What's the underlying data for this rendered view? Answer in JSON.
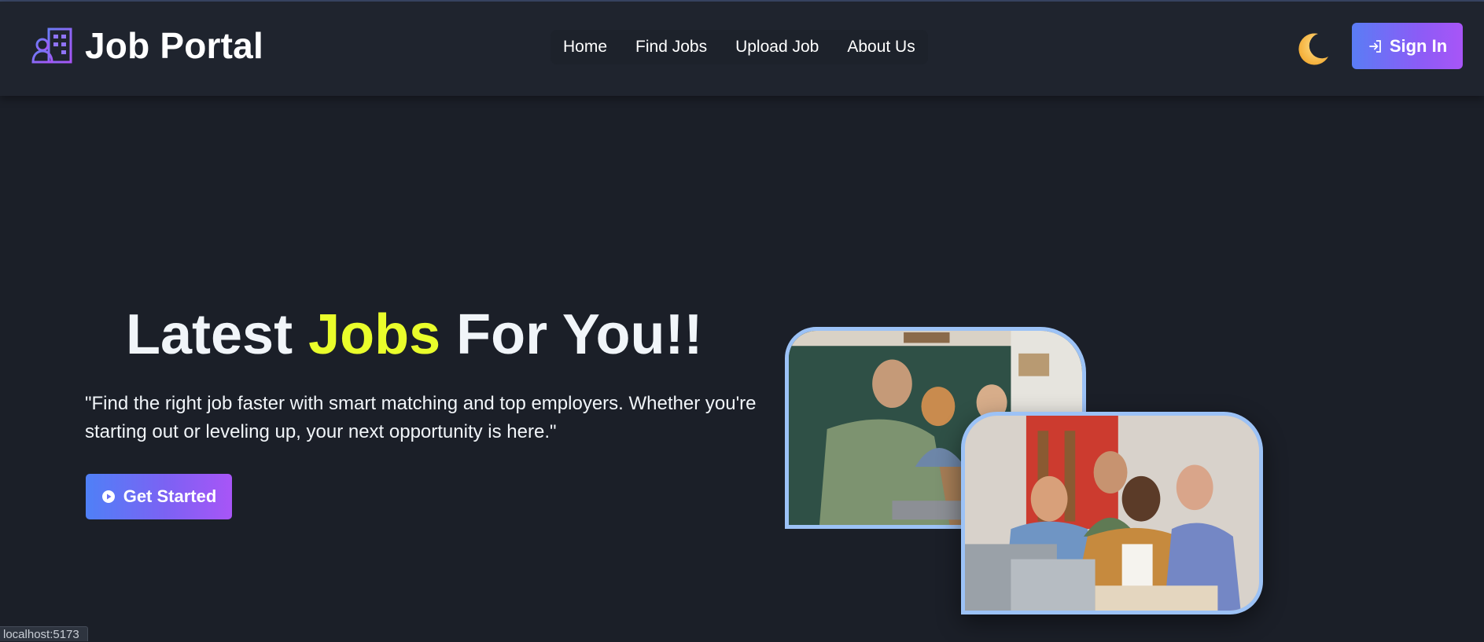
{
  "header": {
    "brand": "Job Portal",
    "nav": [
      "Home",
      "Find Jobs",
      "Upload Job",
      "About Us"
    ],
    "theme_icon": "moon-icon",
    "signin_label": "Sign In"
  },
  "hero": {
    "title_part1": "Latest",
    "title_accent": "Jobs",
    "title_part2": "For You!!",
    "description": "\"Find the right job faster with smart matching and top employers. Whether you're starting out or leveling up, your next opportunity is here.\"",
    "cta_label": "Get Started"
  },
  "status_bar": {
    "url": "localhost:5173"
  },
  "colors": {
    "background": "#1b1f28",
    "header": "#1f242e",
    "accent_yellow": "#e9fd2b",
    "gradient_start": "#4f80f7",
    "gradient_end": "#a855f7",
    "image_border": "#9cc2f6"
  },
  "icons": {
    "logo": "building-person-icon",
    "signin": "sign-in-arrow-icon",
    "cta": "play-circle-icon"
  }
}
